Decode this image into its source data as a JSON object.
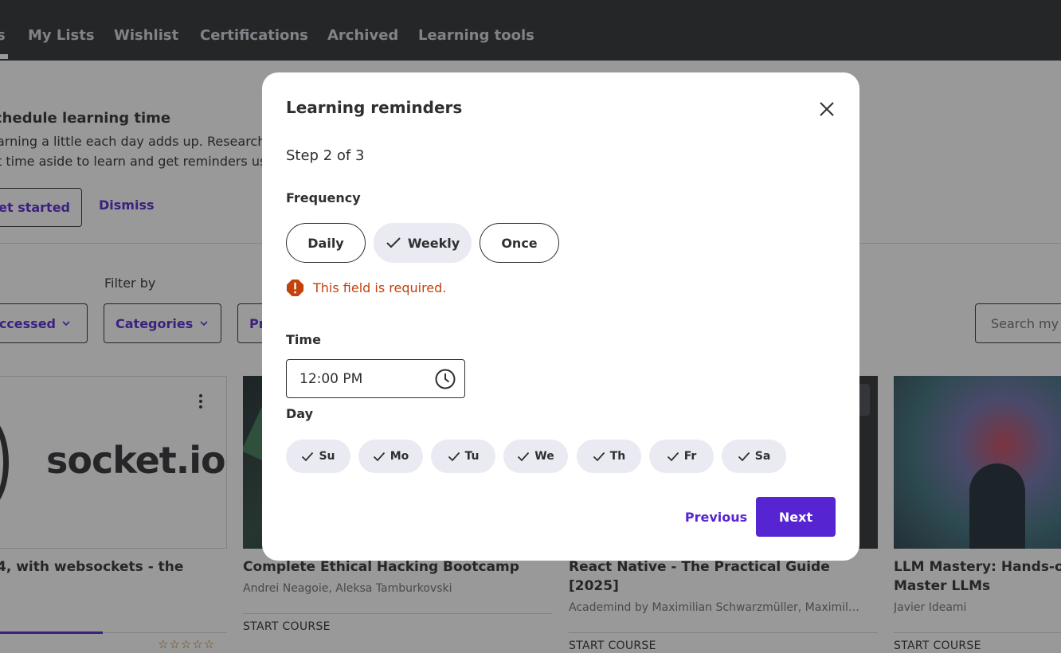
{
  "nav": {
    "tabs": [
      "s",
      "My Lists",
      "Wishlist",
      "Certifications",
      "Archived",
      "Learning tools"
    ]
  },
  "banner": {
    "title": "chedule learning time",
    "line1": "arning a little each day adds up. Research s",
    "line2": "t time aside to learn and get reminders usin",
    "get_started": "Get started",
    "dismiss": "Dismiss"
  },
  "filters": {
    "filter_by_label": "Filter by",
    "sort_value": "ccessed",
    "categories": "Categories",
    "progress_partial": "Pr",
    "search_placeholder": "Search my"
  },
  "courses": [
    {
      "title_line1": "4, with websockets - the",
      "image_text": "socket.io",
      "rating": "☆☆☆☆☆"
    },
    {
      "title_line1": "Complete Ethical Hacking Bootcamp",
      "author": "Andrei Neagoie, Aleksa Tamburkovski",
      "cta": "START COURSE"
    },
    {
      "title_line1": "React Native - The Practical Guide",
      "title_line2": "[2025]",
      "author": "Academind by Maximilian Schwarzmüller, Maximilian…",
      "cta": "START COURSE"
    },
    {
      "title_line1": "LLM Mastery: Hands-o",
      "title_line2": "Master LLMs",
      "author": "Javier Ideami",
      "cta": "START COURSE"
    }
  ],
  "modal": {
    "title": "Learning reminders",
    "step": "Step 2 of 3",
    "frequency_label": "Frequency",
    "frequency_options": [
      "Daily",
      "Weekly",
      "Once"
    ],
    "frequency_selected": "Weekly",
    "error": "This field is required.",
    "time_label": "Time",
    "time_value": "12:00 PM",
    "day_label": "Day",
    "days": [
      "Su",
      "Mo",
      "Tu",
      "We",
      "Th",
      "Fr",
      "Sa"
    ],
    "previous": "Previous",
    "next": "Next"
  },
  "colors": {
    "accent": "#5624d0",
    "error": "#c4410c",
    "selected_pill": "#e9eaf2",
    "nav_bg": "#2d2f31"
  },
  "icons": [
    "close-icon",
    "error-icon",
    "check-icon",
    "clock-icon",
    "chevron-down-icon",
    "kebab-menu-icon"
  ]
}
